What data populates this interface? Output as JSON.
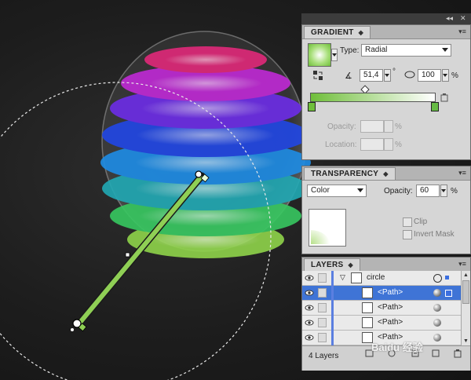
{
  "dock": {
    "collapse_label": "◂◂",
    "close_label": "✕"
  },
  "gradient": {
    "tab_label": "GRADIENT",
    "type_label": "Type:",
    "type_value": "Radial",
    "angle_value": "51,4",
    "degree_symbol": "°",
    "aspect_value": "100",
    "aspect_unit": "%",
    "opacity_label": "Opacity:",
    "opacity_unit": "%",
    "location_label": "Location:",
    "location_unit": "%",
    "stop_left_color": "#6fbe3a",
    "stop_right_color": "#ffffff"
  },
  "transparency": {
    "tab_label": "TRANSPARENCY",
    "blend_mode": "Color",
    "opacity_label": "Opacity:",
    "opacity_value": "60",
    "opacity_unit": "%",
    "clip_label": "Clip",
    "invert_mask_label": "Invert Mask"
  },
  "layers": {
    "tab_label": "LAYERS",
    "rows": [
      {
        "name": "circle"
      },
      {
        "name": "<Path>"
      },
      {
        "name": "<Path>"
      },
      {
        "name": "<Path>"
      },
      {
        "name": "<Path>"
      }
    ],
    "count_label": "4 Layers"
  },
  "watermark": "Baidu 经验"
}
